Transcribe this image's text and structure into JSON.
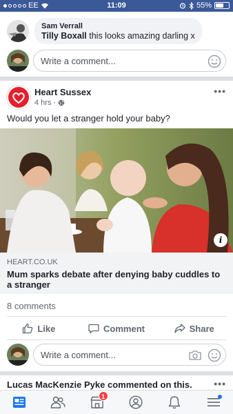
{
  "status_bar": {
    "carrier": "EE",
    "time": "11:09",
    "battery_text": "55%",
    "battery_level": 0.55
  },
  "top_comment": {
    "author": "Sam Verrall",
    "tagged_name": "Tilly Boxall",
    "text": " this looks amazing darling x"
  },
  "write_comment_placeholder": "Write a comment...",
  "post": {
    "page_name": "Heart Sussex",
    "time": "4 hrs",
    "text": "Would you let a stranger hold your baby?",
    "link": {
      "domain": "HEART.CO.UK",
      "title": "Mum sparks debate after denying baby cuddles to a stranger"
    },
    "comment_count": "8 comments"
  },
  "actions": {
    "like": "Like",
    "comment": "Comment",
    "share": "Share"
  },
  "activity": {
    "text": "Lucas MacKenzie Pyke commented on this."
  },
  "tab_bar": {
    "tabs": [
      {
        "icon": "news-feed-icon",
        "active": true
      },
      {
        "icon": "friends-icon"
      },
      {
        "icon": "marketplace-icon",
        "badge": "1"
      },
      {
        "icon": "profile-icon"
      },
      {
        "icon": "notifications-bell-icon"
      },
      {
        "icon": "menu-icon"
      }
    ]
  },
  "colors": {
    "brand_blue": "#3b5998",
    "heart_red": "#e5202e",
    "badge_red": "#fa3e3e"
  }
}
